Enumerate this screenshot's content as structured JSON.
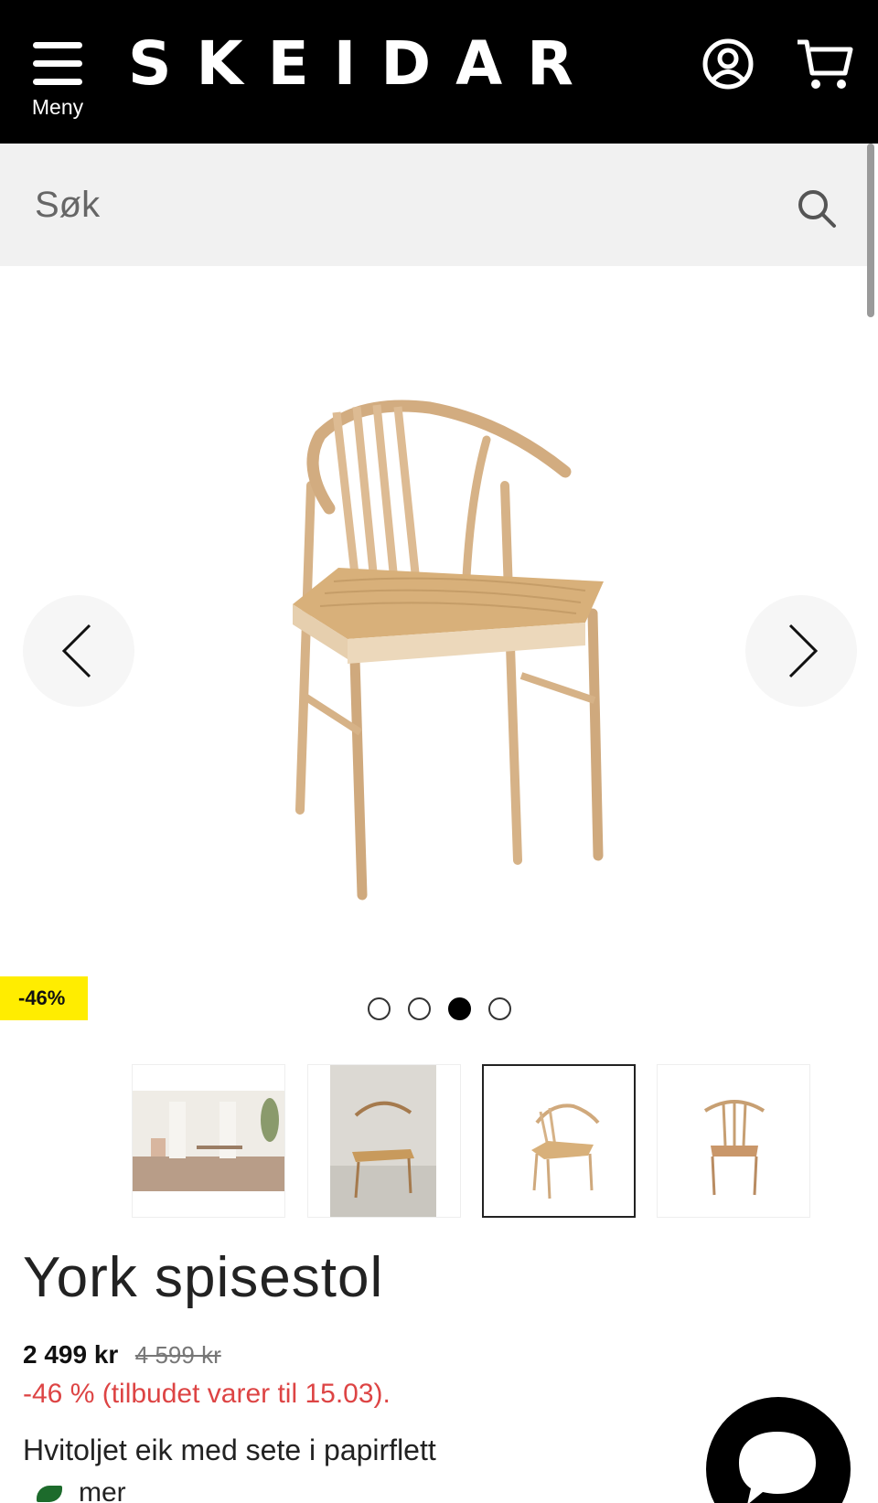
{
  "header": {
    "menu_label": "Meny",
    "logo_text": "SKEIDAR",
    "account_icon": "account-icon",
    "cart_icon": "cart-icon",
    "background": "#000000"
  },
  "search": {
    "placeholder": "Søk",
    "icon": "search-icon"
  },
  "gallery": {
    "discount_badge": "-46%",
    "badge_color": "#ffed00",
    "active_index": 2,
    "dot_count": 4,
    "thumbnails": [
      "room-scene",
      "chair-in-room",
      "chair-front",
      "chair-back"
    ]
  },
  "product": {
    "title": "York spisestol",
    "price": "2 499 kr",
    "old_price": "4 599 kr",
    "offer_text": "-46 % (tilbudet varer til 15.03).",
    "description": "Hvitoljet eik med sete i papirflett",
    "more_label": "mer"
  },
  "colors": {
    "offer": "#dd4444",
    "wood": "#d8b58a",
    "seat": "#d9b27a"
  }
}
